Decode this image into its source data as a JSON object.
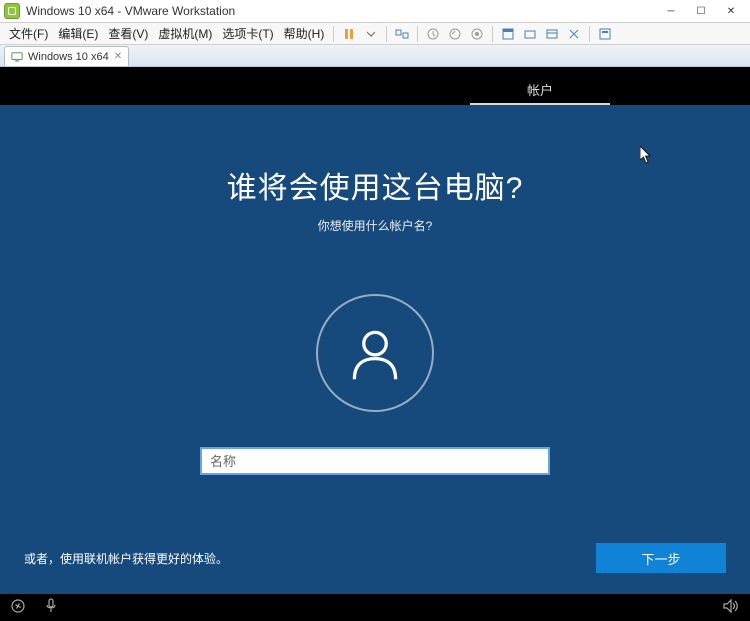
{
  "window": {
    "title": "Windows 10 x64 - VMware Workstation"
  },
  "menu": {
    "file": "文件(F)",
    "edit": "编辑(E)",
    "view": "查看(V)",
    "vm": "虚拟机(M)",
    "tabs": "选项卡(T)",
    "help": "帮助(H)"
  },
  "tabs": {
    "t0": {
      "label": "Windows 10 x64"
    }
  },
  "oobe": {
    "top_tab": "帐户",
    "heading": "谁将会使用这台电脑?",
    "subheading": "你想使用什么帐户名?",
    "name_placeholder": "名称",
    "footer_link": "或者，使用联机帐户获得更好的体验。",
    "next": "下一步"
  }
}
